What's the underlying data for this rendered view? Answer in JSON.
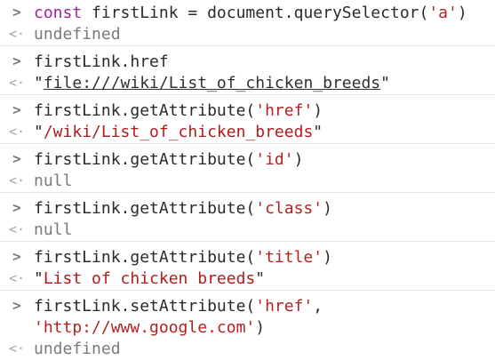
{
  "console": {
    "input_prompt_icon": "chevron-right-icon",
    "output_prompt_icon": "return-arrow-icon",
    "entries": [
      {
        "input": [
          "const firstLink = document.querySelector(",
          "'a'",
          ")"
        ],
        "output": "undefined",
        "output_type": "undefined"
      },
      {
        "input": [
          "firstLink.href"
        ],
        "output": "file:///wiki/List_of_chicken_breeds",
        "output_type": "link"
      },
      {
        "input": [
          "firstLink.getAttribute(",
          "'href'",
          ")"
        ],
        "output": "/wiki/List_of_chicken_breeds",
        "output_type": "string"
      },
      {
        "input": [
          "firstLink.getAttribute(",
          "'id'",
          ")"
        ],
        "output": "null",
        "output_type": "null"
      },
      {
        "input": [
          "firstLink.getAttribute(",
          "'class'",
          ")"
        ],
        "output": "null",
        "output_type": "null"
      },
      {
        "input": [
          "firstLink.getAttribute(",
          "'title'",
          ")"
        ],
        "output": "List of chicken breeds",
        "output_type": "string"
      },
      {
        "input": [
          "firstLink.setAttribute(",
          "'href'",
          ","
        ],
        "input_cont": [
          "'http://www.google.com'",
          ")"
        ],
        "output": "undefined",
        "output_type": "undefined"
      }
    ]
  },
  "colors": {
    "keyword": "#a3239a",
    "string": "#b22222",
    "muted": "#7a7a7a"
  }
}
